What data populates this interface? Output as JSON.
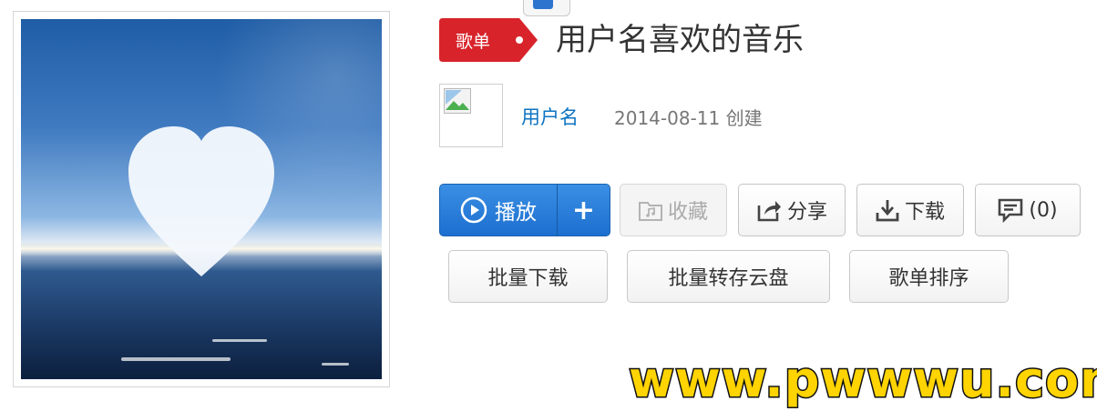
{
  "cover": {
    "alt": "heart-cover-art"
  },
  "header": {
    "badge_label": "歌单",
    "title": "用户名喜欢的音乐"
  },
  "creator": {
    "name": "用户名",
    "created": "2014-08-11 创建"
  },
  "actions": {
    "play_label": "播放",
    "add_label": "+",
    "favorite_label": "收藏",
    "share_label": "分享",
    "download_label": "下载",
    "comment_label": "(0)"
  },
  "secondary_actions": {
    "batch_download": "批量下载",
    "batch_save_cloud": "批量转存云盘",
    "sort_playlist": "歌单排序"
  },
  "watermark": "www.pwwwu.com",
  "colors": {
    "badge_red": "#d8232a",
    "play_blue": "#1c6fcf",
    "link_blue": "#0c73c2"
  }
}
